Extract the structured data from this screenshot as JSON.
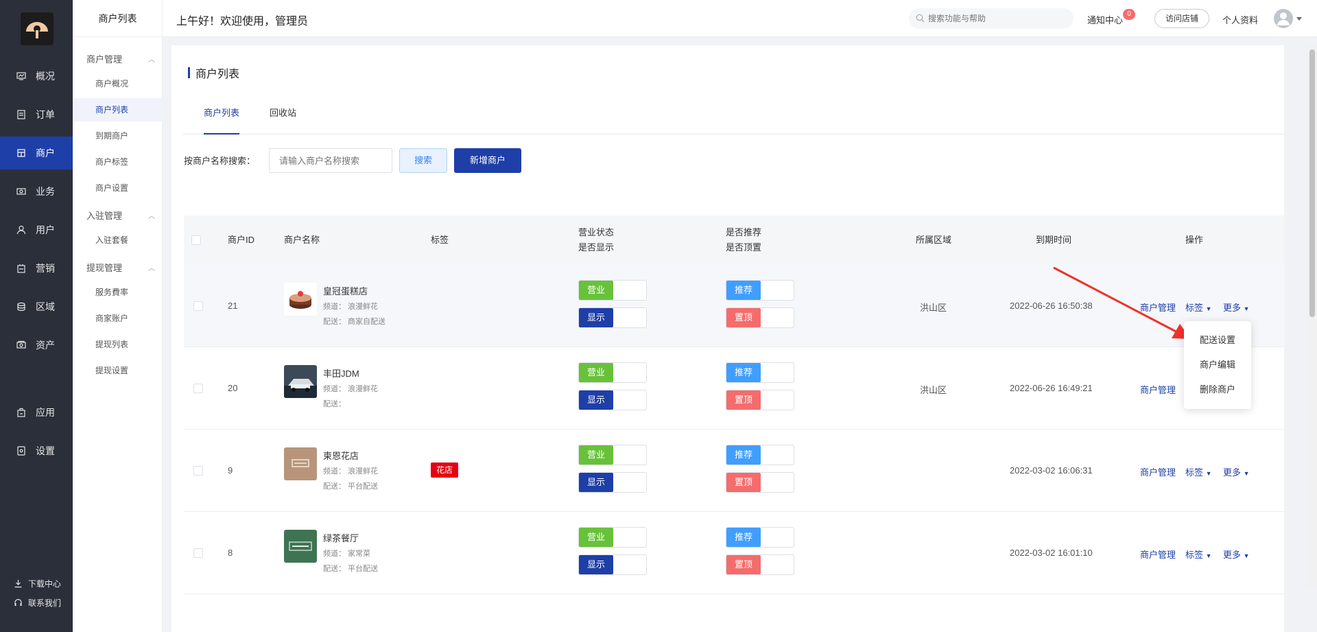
{
  "nav": {
    "items": [
      {
        "label": "概况",
        "icon": "dashboard-icon"
      },
      {
        "label": "订单",
        "icon": "order-icon"
      },
      {
        "label": "商户",
        "icon": "merchant-icon"
      },
      {
        "label": "业务",
        "icon": "business-icon"
      },
      {
        "label": "用户",
        "icon": "user-icon"
      },
      {
        "label": "营销",
        "icon": "marketing-icon"
      },
      {
        "label": "区域",
        "icon": "region-icon"
      },
      {
        "label": "资产",
        "icon": "asset-icon"
      },
      {
        "label": "应用",
        "icon": "app-icon"
      },
      {
        "label": "设置",
        "icon": "settings-icon"
      }
    ],
    "download": "下载中心",
    "contact": "联系我们"
  },
  "subnav": {
    "title": "商户列表",
    "groups": [
      {
        "label": "商户管理",
        "items": [
          "商户概况",
          "商户列表",
          "到期商户",
          "商户标签",
          "商户设置"
        ]
      },
      {
        "label": "入驻管理",
        "items": [
          "入驻套餐"
        ]
      },
      {
        "label": "提现管理",
        "items": [
          "服务費率",
          "商家账户",
          "提现列表",
          "提现设置"
        ]
      }
    ]
  },
  "header": {
    "greeting": "上午好！欢迎使用，管理员",
    "search_placeholder": "搜索功能与帮助",
    "notify": "通知中心",
    "notify_count": "0",
    "visit": "访问店铺",
    "profile": "个人资料"
  },
  "page": {
    "title": "商户列表",
    "tabs": [
      "商户列表",
      "回收站"
    ],
    "filter_label": "按商户名称搜索：",
    "filter_placeholder": "请输入商户名称搜索",
    "search_btn": "搜索",
    "add_btn": "新增商户"
  },
  "table": {
    "headers": {
      "id": "商户ID",
      "name": "商户名称",
      "tag": "标签",
      "status1": "营业状态",
      "status2": "是否显示",
      "rec1": "是否推荐",
      "rec2": "是否顶置",
      "region": "所属区域",
      "expire": "到期时间",
      "ops": "操作"
    },
    "switch_labels": {
      "open": "营业",
      "show": "显示",
      "recommend": "推荐",
      "top": "置顶"
    },
    "op_labels": {
      "manage": "商户管理",
      "tag": "标签",
      "more": "更多"
    },
    "rows": [
      {
        "id": "21",
        "name": "皇冠蛋糕店",
        "channel": "频道： 浪漫鲜花",
        "delivery": "配送： 商家自配送",
        "tag": "",
        "region": "洪山区",
        "expire": "2022-06-26 16:50:38"
      },
      {
        "id": "20",
        "name": "丰田JDM",
        "channel": "频道： 浪漫鲜花",
        "delivery": "配送：",
        "tag": "",
        "region": "洪山区",
        "expire": "2022-06-26 16:49:21"
      },
      {
        "id": "9",
        "name": "柬恩花店",
        "channel": "频道： 浪漫鲜花",
        "delivery": "配送： 平台配送",
        "tag": "花店",
        "region": "",
        "expire": "2022-03-02 16:06:31"
      },
      {
        "id": "8",
        "name": "绿茶餐厅",
        "channel": "频道： 家常菜",
        "delivery": "配送： 平台配送",
        "tag": "",
        "region": "",
        "expire": "2022-03-02 16:01:10"
      }
    ]
  },
  "dropdown": {
    "items": [
      "配送设置",
      "商户编辑",
      "删除商户"
    ]
  },
  "colors": {
    "primary": "#1e3fa8",
    "sidebar": "#2b2f3a",
    "arrow": "#f0312a"
  }
}
